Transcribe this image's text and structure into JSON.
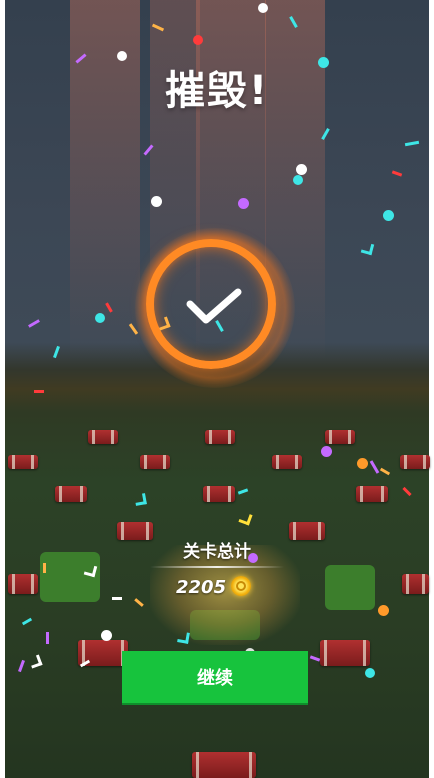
{
  "screen": {
    "title": "摧毁!",
    "result_icon": "checkmark-ring-icon",
    "stats": {
      "label": "关卡总计",
      "value": "2205",
      "currency_icon": "gold-coin-icon"
    },
    "continue_button": {
      "label": "继续"
    }
  },
  "colors": {
    "ring": "#ff8a24",
    "button": "#17c33d",
    "text": "#ffffff",
    "coin": "#f2b10f"
  }
}
